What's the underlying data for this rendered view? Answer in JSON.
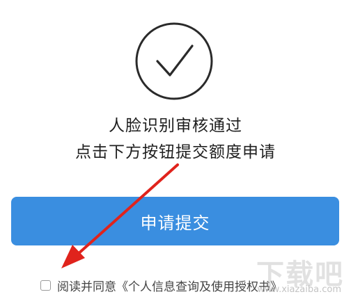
{
  "status": {
    "icon": "check-circle-icon",
    "line1": "人脸识别审核通过",
    "line2": "点击下方按钮提交额度申请"
  },
  "actions": {
    "submit_label": "申请提交",
    "submit_color": "#3a8ee0"
  },
  "agreement": {
    "checked": false,
    "prefix": "阅读并同意",
    "link_text": "《个人信息查询及使用授权书》"
  },
  "annotation": {
    "arrow_color": "#e0231c",
    "arrow_icon": "red-arrow-pointer"
  },
  "watermark": {
    "logo_text": "下载吧",
    "url_text": "www.xiazaiba.com"
  }
}
